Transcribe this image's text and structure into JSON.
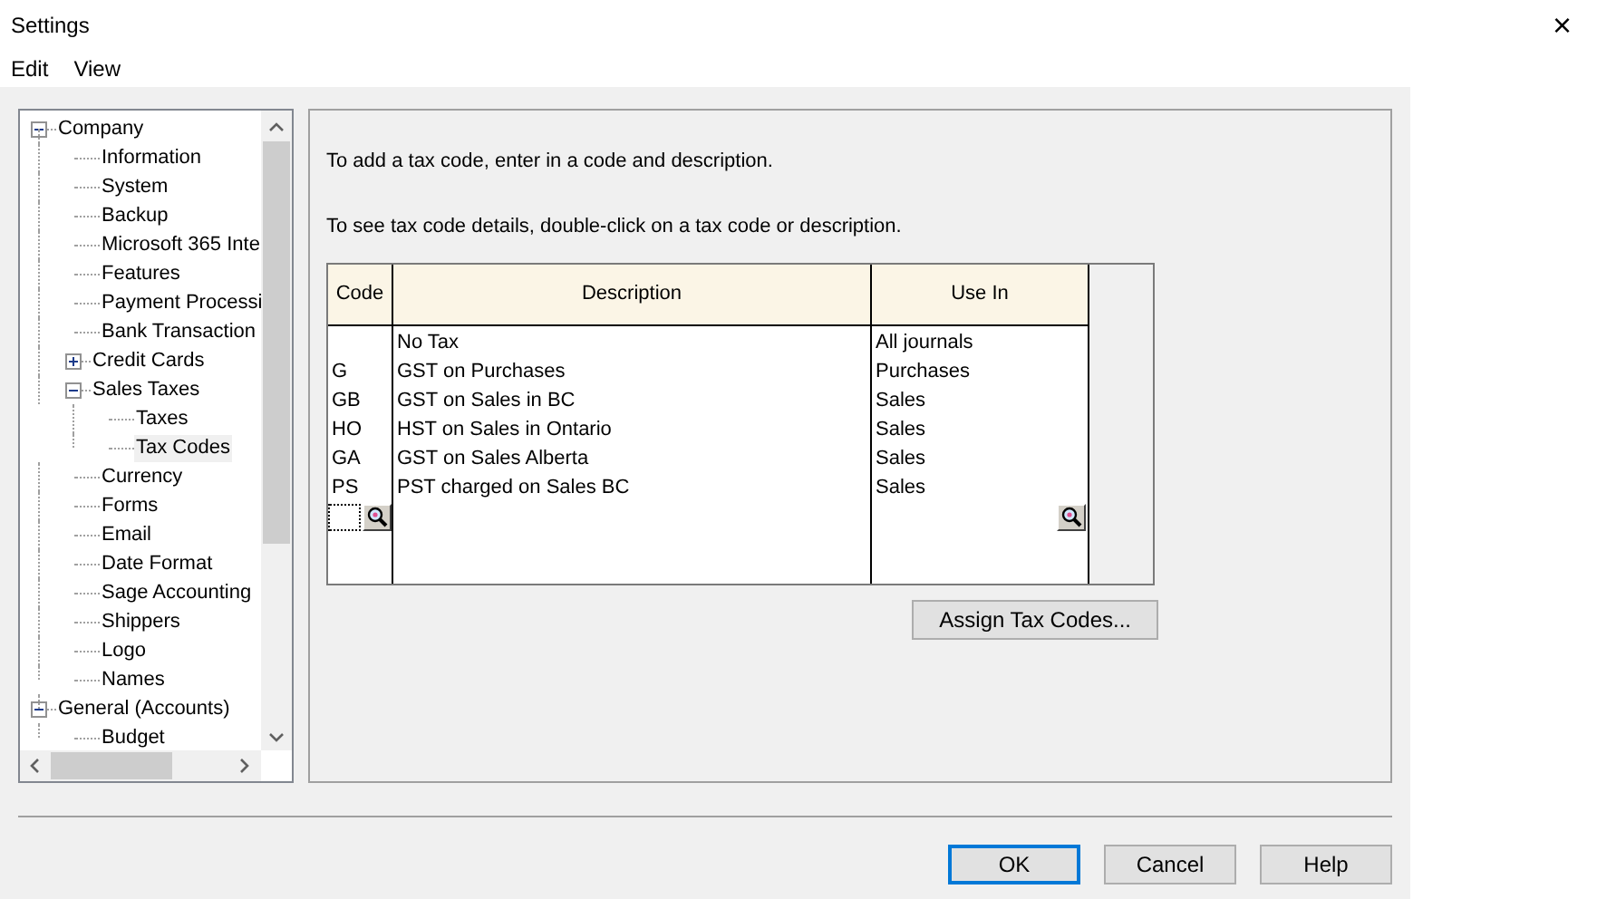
{
  "window": {
    "title": "Settings",
    "close": "×"
  },
  "menu": [
    "Edit",
    "View"
  ],
  "tree": [
    {
      "label": "Company",
      "expanded": true,
      "selected": false,
      "children": [
        {
          "label": "Information",
          "selected": false
        },
        {
          "label": "System",
          "selected": false
        },
        {
          "label": "Backup",
          "selected": false
        },
        {
          "label": "Microsoft 365 Inte",
          "selected": false
        },
        {
          "label": "Features",
          "selected": false
        },
        {
          "label": "Payment Processi",
          "selected": false
        },
        {
          "label": "Bank Transaction",
          "selected": false
        },
        {
          "label": "Credit Cards",
          "expanded": false,
          "selected": false
        },
        {
          "label": "Sales Taxes",
          "expanded": true,
          "selected": false,
          "children": [
            {
              "label": "Taxes",
              "selected": false
            },
            {
              "label": "Tax Codes",
              "selected": true
            }
          ]
        },
        {
          "label": "Currency",
          "selected": false
        },
        {
          "label": "Forms",
          "selected": false
        },
        {
          "label": "Email",
          "selected": false
        },
        {
          "label": "Date Format",
          "selected": false
        },
        {
          "label": "Sage Accounting",
          "selected": false
        },
        {
          "label": "Shippers",
          "selected": false
        },
        {
          "label": "Logo",
          "selected": false
        },
        {
          "label": "Names",
          "selected": false
        }
      ]
    },
    {
      "label": "General (Accounts)",
      "expanded": true,
      "selected": false,
      "children": [
        {
          "label": "Budget",
          "selected": false
        }
      ]
    }
  ],
  "instructions": [
    "To add a tax code, enter in a code and description.",
    "To see tax code details, double-click on a tax code or description."
  ],
  "table": {
    "columns": [
      "Code",
      "Description",
      "Use In"
    ],
    "rows": [
      {
        "description": "No Tax",
        "use_in": "All journals"
      },
      {
        "code": "G",
        "description": "GST on Purchases",
        "use_in": "Purchases"
      },
      {
        "code": "GB",
        "description": "GST on Sales in BC",
        "use_in": "Sales"
      },
      {
        "code": "HO",
        "description": "HST on Sales in Ontario",
        "use_in": "Sales"
      },
      {
        "code": "GA",
        "description": "GST on Sales Alberta",
        "use_in": "Sales"
      },
      {
        "code": "PS",
        "description": "PST charged on Sales BC",
        "use_in": "Sales"
      }
    ]
  },
  "assign_button": "Assign Tax Codes...",
  "buttons": [
    {
      "label": "OK",
      "default": true
    },
    {
      "label": "Cancel",
      "default": false
    },
    {
      "label": "Help",
      "default": false
    }
  ]
}
